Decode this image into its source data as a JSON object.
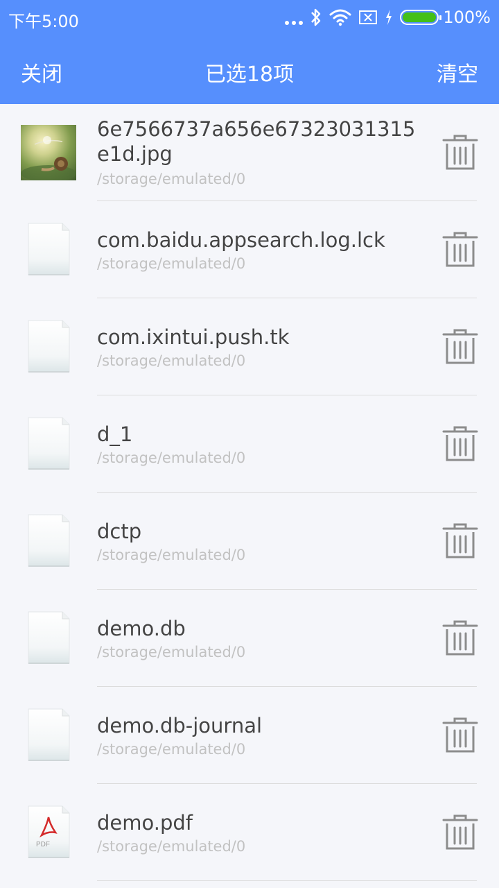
{
  "status_bar": {
    "time": "下午5:00",
    "battery_percent": "100%",
    "battery_level": 1.0,
    "battery_color": "#44c018",
    "icons": [
      "more-dots-icon",
      "bluetooth-icon",
      "wifi-icon",
      "sim-none-icon",
      "charging-icon",
      "battery-icon"
    ]
  },
  "header": {
    "close_label": "关闭",
    "title": "已选18项",
    "clear_label": "清空",
    "background_color": "#568ffd"
  },
  "files": [
    {
      "name": "6e7566737a656e67323031315e1d.jpg",
      "path": "/storage/emulated/0",
      "icon": "image-thumbnail"
    },
    {
      "name": "com.baidu.appsearch.log.lck",
      "path": "/storage/emulated/0",
      "icon": "file-icon"
    },
    {
      "name": "com.ixintui.push.tk",
      "path": "/storage/emulated/0",
      "icon": "file-icon"
    },
    {
      "name": "d_1",
      "path": "/storage/emulated/0",
      "icon": "file-icon"
    },
    {
      "name": "dctp",
      "path": "/storage/emulated/0",
      "icon": "file-icon"
    },
    {
      "name": "demo.db",
      "path": "/storage/emulated/0",
      "icon": "file-icon"
    },
    {
      "name": "demo.db-journal",
      "path": "/storage/emulated/0",
      "icon": "file-icon"
    },
    {
      "name": "demo.pdf",
      "path": "/storage/emulated/0",
      "icon": "pdf-file-icon",
      "icon_text": "PDF"
    }
  ],
  "row_action_icon": "trash-icon"
}
